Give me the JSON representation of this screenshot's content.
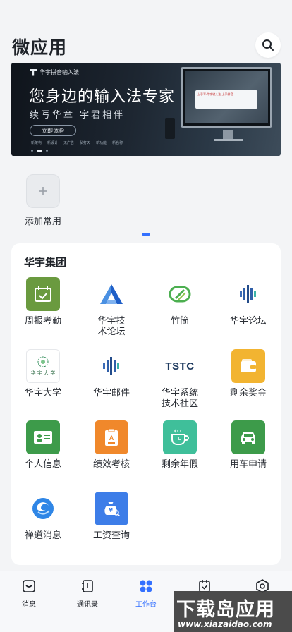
{
  "header": {
    "title": "微应用",
    "search_icon": "search-icon"
  },
  "banner": {
    "brand": "华宇拼音输入法",
    "title": "您身边的输入法专家",
    "subtitle": "续写华章 宇君相伴",
    "cta": "立即体验",
    "tags": [
      "新架构",
      "新设计",
      "无广告",
      "私打天",
      "新功能",
      "新名称"
    ],
    "monitor_popup": "上手写·华宇输入法 上手拼音"
  },
  "favorites": {
    "add_label": "添加常用",
    "add_icon": "plus-icon"
  },
  "group": {
    "title": "华宇集团",
    "apps": [
      {
        "label": "周报考勤",
        "icon": "calendar-check-icon",
        "color": "#6a9a3f"
      },
      {
        "label": "华宇技术论坛",
        "icon": "triangle-logo-icon",
        "color": "#2f6fd8"
      },
      {
        "label": "竹简",
        "icon": "bamboo-slip-icon",
        "color": "#4caf50"
      },
      {
        "label": "华宇论坛",
        "icon": "waveform-logo-icon",
        "color": "#2f5fa8"
      },
      {
        "label": "华宇大学",
        "icon": "university-logo-icon",
        "logo_text": "华 宇 大 学",
        "color": "#2e8b57"
      },
      {
        "label": "华宇邮件",
        "icon": "waveform-logo-icon",
        "color": "#2f5fa8"
      },
      {
        "label": "华宇系统技术社区",
        "icon": "tstc-logo-icon",
        "logo_text": "TSTC",
        "color": "#1e3a5f"
      },
      {
        "label": "剩余奖金",
        "icon": "wallet-icon",
        "color": "#f2b431"
      },
      {
        "label": "个人信息",
        "icon": "id-card-icon",
        "color": "#3d9b4a"
      },
      {
        "label": "绩效考核",
        "icon": "clipboard-grade-icon",
        "color": "#f0882b"
      },
      {
        "label": "剩余年假",
        "icon": "coffee-cup-icon",
        "color": "#3fbf9a"
      },
      {
        "label": "用车申请",
        "icon": "car-icon",
        "color": "#3d9b4a"
      },
      {
        "label": "禅道消息",
        "icon": "zentao-logo-icon",
        "color": "#2f86e6"
      },
      {
        "label": "工资查询",
        "icon": "salary-bag-icon",
        "color": "#3d7de8"
      }
    ]
  },
  "tabbar": {
    "tabs": [
      {
        "label": "消息",
        "icon": "message-icon",
        "active": false
      },
      {
        "label": "通讯录",
        "icon": "contacts-book-icon",
        "active": false
      },
      {
        "label": "工作台",
        "icon": "workbench-grid-icon",
        "active": true
      },
      {
        "label": "",
        "icon": "task-check-icon",
        "active": false
      },
      {
        "label": "",
        "icon": "settings-hexagon-icon",
        "active": false
      }
    ]
  },
  "watermark": {
    "title": "下载岛应用",
    "url": "www.xiazaidao.com"
  },
  "colors": {
    "accent": "#3370ff",
    "background": "#f3f4f6"
  }
}
